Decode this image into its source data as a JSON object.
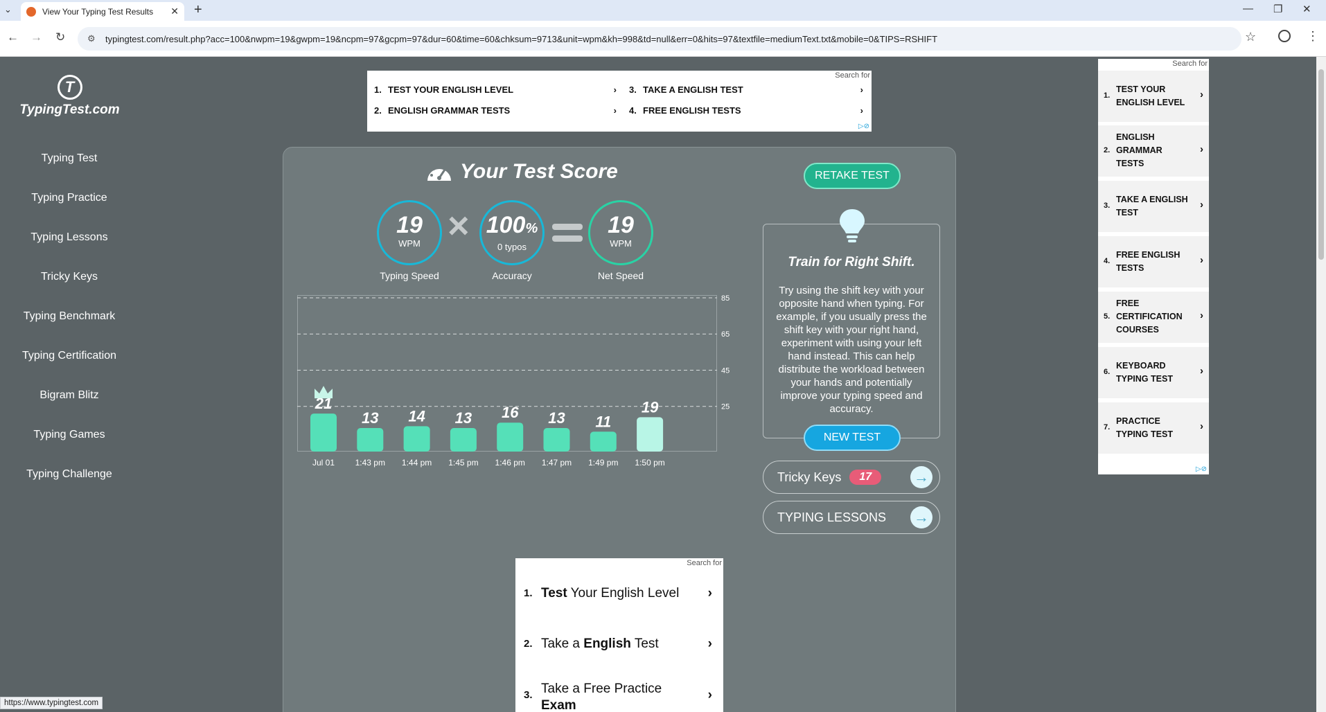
{
  "browser": {
    "tab_title": "View Your Typing Test Results",
    "tab_close": "✕",
    "new_tab": "+",
    "url": "typingtest.com/result.php?acc=100&nwpm=19&gwpm=19&ncpm=97&gcpm=97&dur=60&time=60&chksum=9713&unit=wpm&kh=998&td=null&err=0&hits=97&textfile=mediumText.txt&mobile=0&TIPS=RSHIFT",
    "status_url": "https://www.typingtest.com"
  },
  "logo": {
    "mark": "T",
    "wordmark": "TypingTest.com"
  },
  "sidebar": {
    "items": [
      {
        "label": "Typing Test"
      },
      {
        "label": "Typing Practice"
      },
      {
        "label": "Typing Lessons"
      },
      {
        "label": "Tricky Keys"
      },
      {
        "label": "Typing Benchmark"
      },
      {
        "label": "Typing Certification"
      },
      {
        "label": "Bigram Blitz"
      },
      {
        "label": "Typing Games"
      },
      {
        "label": "Typing Challenge"
      }
    ]
  },
  "top_ad": {
    "search_for": "Search for",
    "items": [
      {
        "num": "1.",
        "label": "TEST YOUR ENGLISH LEVEL"
      },
      {
        "num": "2.",
        "label": "ENGLISH GRAMMAR TESTS"
      },
      {
        "num": "3.",
        "label": "TAKE A ENGLISH TEST"
      },
      {
        "num": "4.",
        "label": "FREE ENGLISH TESTS"
      }
    ]
  },
  "score": {
    "title": "Your Test Score",
    "typing_speed": {
      "value": "19",
      "unit": "WPM",
      "label": "Typing Speed"
    },
    "accuracy": {
      "value": "100",
      "unit_sym": "%",
      "typos": "0 typos",
      "label": "Accuracy"
    },
    "net_speed": {
      "value": "19",
      "unit": "WPM",
      "label": "Net Speed"
    },
    "times": "×"
  },
  "chart_data": {
    "type": "bar",
    "categories": [
      "Jul 01",
      "1:43 pm",
      "1:44 pm",
      "1:45 pm",
      "1:46 pm",
      "1:47 pm",
      "1:49 pm",
      "1:50 pm"
    ],
    "values": [
      21,
      13,
      14,
      13,
      16,
      13,
      11,
      19
    ],
    "yticks": [
      25,
      45,
      65,
      85
    ],
    "ylim": [
      0,
      85
    ],
    "best_index": 0,
    "current_index": 7,
    "bar_color": "#55e0b8",
    "current_bar_color": "#b8f5e6",
    "grid": "dashed"
  },
  "right": {
    "retake_label": "RETAKE TEST",
    "tip_title": "Train for Right Shift.",
    "tip_body": "Try using the shift key with your opposite hand when typing. For example, if you usually press the shift key with your right hand, experiment with using your left hand instead. This can help distribute the workload between your hands and potentially improve your typing speed and accuracy.",
    "new_test_label": "NEW TEST",
    "tricky_keys_label": "Tricky Keys",
    "tricky_keys_count": "17",
    "typing_lessons_label": "TYPING LESSONS"
  },
  "bottom_ad": {
    "search_for": "Search for",
    "items": [
      {
        "num": "1.",
        "bold": "Test",
        "rest": " Your English Level"
      },
      {
        "num": "2.",
        "pre": "Take a ",
        "bold": "English",
        "rest": " Test"
      },
      {
        "num": "3.",
        "pre": "Take a Free Practice ",
        "bold": "Exam",
        "rest": ""
      }
    ]
  },
  "right_ad": {
    "search_for": "Search for",
    "items": [
      {
        "num": "1.",
        "label": "TEST YOUR ENGLISH LEVEL"
      },
      {
        "num": "2.",
        "label": "ENGLISH GRAMMAR TESTS"
      },
      {
        "num": "3.",
        "label": "TAKE A ENGLISH TEST"
      },
      {
        "num": "4.",
        "label": "FREE ENGLISH TESTS"
      },
      {
        "num": "5.",
        "label": "FREE CERTIFICATION COURSES"
      },
      {
        "num": "6.",
        "label": "KEYBOARD TYPING TEST"
      },
      {
        "num": "7.",
        "label": "PRACTICE TYPING TEST"
      }
    ]
  },
  "icons": {
    "chevron": "›",
    "arrow": "→",
    "adchoices": "▷⊘"
  }
}
